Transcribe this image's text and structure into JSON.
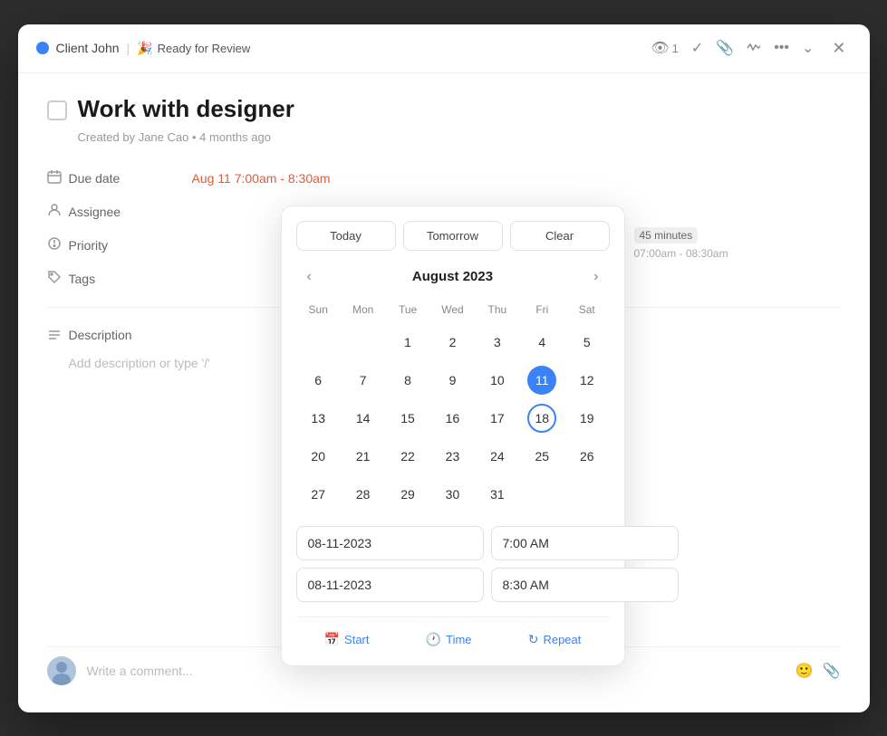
{
  "header": {
    "project_name": "Client John",
    "separator": "|",
    "status_emoji": "🎉",
    "status_label": "Ready for Review",
    "view_count": "1",
    "close_label": "×"
  },
  "task": {
    "title": "Work with designer",
    "created_by": "Created by Jane Cao",
    "time_ago": "4 months ago",
    "fields": {
      "due_date_label": "Due date",
      "due_date_value": "Aug 11 7:00am - 8:30am",
      "assignee_label": "Assignee",
      "priority_label": "Priority",
      "tags_label": "Tags",
      "description_label": "Description",
      "description_placeholder": "Add description or type '/'"
    }
  },
  "calendar": {
    "today_label": "Today",
    "tomorrow_label": "Tomorrow",
    "clear_label": "Clear",
    "month_year": "August 2023",
    "days_of_week": [
      "Sun",
      "Mon",
      "Tue",
      "Wed",
      "Thu",
      "Fri",
      "Sat"
    ],
    "weeks": [
      [
        "",
        "",
        "1",
        "2",
        "3",
        "4",
        "5"
      ],
      [
        "6",
        "7",
        "8",
        "9",
        "10",
        "11",
        "12"
      ],
      [
        "13",
        "14",
        "15",
        "16",
        "17",
        "18",
        "19"
      ],
      [
        "20",
        "21",
        "22",
        "23",
        "24",
        "25",
        "26"
      ],
      [
        "27",
        "28",
        "29",
        "30",
        "31",
        "",
        ""
      ]
    ],
    "selected_day": "11",
    "today_ring_day": "18",
    "start_date": "08-11-2023",
    "start_time": "7:00 AM",
    "end_date": "08-11-2023",
    "end_time": "8:30 AM",
    "footer": {
      "start_label": "Start",
      "time_label": "Time",
      "repeat_label": "Repeat"
    }
  },
  "comment": {
    "placeholder": "Write a comment..."
  },
  "right_panel": {
    "duration": "45 minutes",
    "time_range": "07:00am - 08:30am"
  },
  "icons": {
    "eye": "👁",
    "check_circle": "✓",
    "paperclip": "📎",
    "activity": "〜",
    "more": "•••",
    "chevron_down": "⌄",
    "calendar": "📅",
    "person": "👤",
    "priority": "⊙",
    "tag": "🏷",
    "lines": "≡",
    "start_cal": "📅",
    "clock": "🕐",
    "repeat": "↻"
  }
}
